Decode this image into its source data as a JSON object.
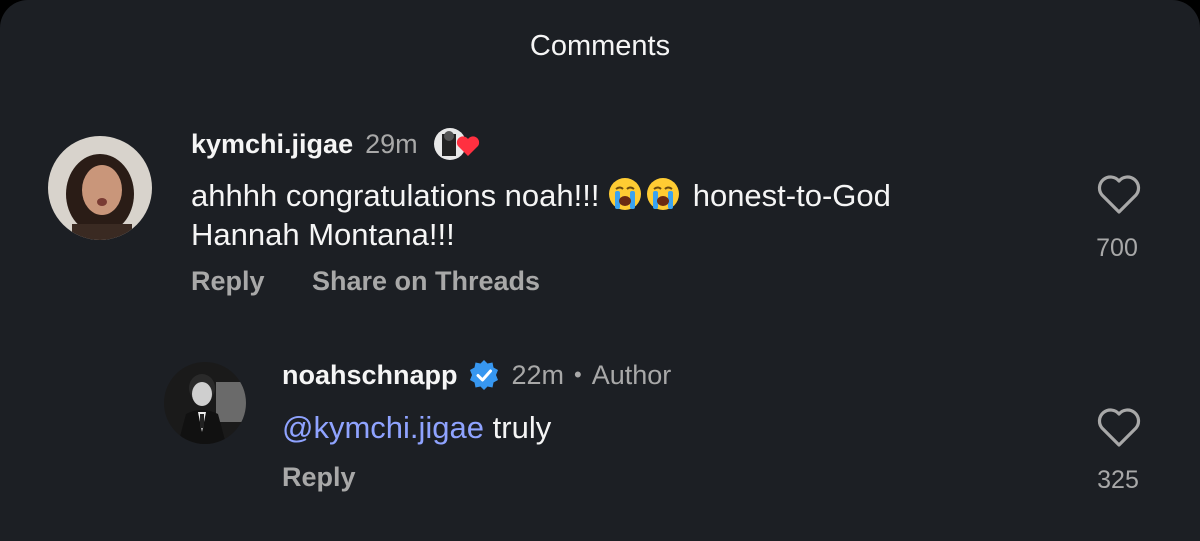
{
  "header": {
    "title": "Comments"
  },
  "comments": [
    {
      "username": "kymchi.jigae",
      "time": "29m",
      "text_part1": "ahhhh congratulations noah!!! ",
      "emoji_name": "loudly-crying-face-icon",
      "text_part2": " honest-to-God",
      "text_line2": "Hannah Montana!!!",
      "reply_label": "Reply",
      "share_label": "Share on Threads",
      "like_count": "700"
    },
    {
      "username": "noahschnapp",
      "time": "22m",
      "separator": "•",
      "author_badge": "Author",
      "mention": "@kymchi.jigae",
      "text": " truly",
      "reply_label": "Reply",
      "like_count": "325"
    }
  ],
  "colors": {
    "background": "#1c1f24",
    "mention": "#8fa3ff",
    "muted": "#a8a8a8",
    "verified": "#3797f0",
    "heart_red": "#ff3040"
  }
}
